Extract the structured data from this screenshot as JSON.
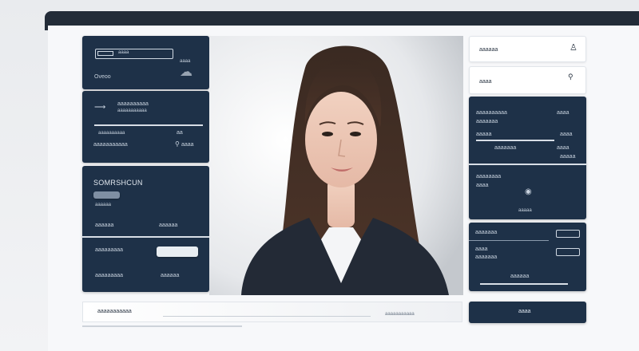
{
  "app": {
    "colors": {
      "panel": "#1e3148",
      "screen": "#f7f8fa",
      "light_card": "#ffffff",
      "text_light": "#c6d0dc"
    }
  },
  "panel_login": {
    "input_label": "aaaa",
    "caption": "Oveoo",
    "icon": "cloud-icon",
    "icon_label": "aaaa"
  },
  "panel_info": {
    "heading": "aaaaaaaaaa",
    "subheading": "aaaaaaaaaaa",
    "row1_label": "aaaaaaaaaa",
    "row1_value": "aa",
    "row2_label": "aaaaaaaaaaa",
    "row2_value": "aaaa"
  },
  "panel_search": {
    "title": "SOMRSHCUN",
    "item1_left": "aaaaaa",
    "item1_right": "aaaaaa",
    "row_label": "aaaaaa",
    "row2_left": "aaaaaaaaa",
    "row2_right": "aaaaaa"
  },
  "right_cards": {
    "card1_label": "aaaaaa",
    "card1_icon": "person-icon",
    "card2_label": "aaaa",
    "card2_icon": "pin-icon"
  },
  "panel_stats": {
    "title": "aaaaaaaaaa",
    "sub": "aaaaaaa",
    "row1_left": "aaaaa",
    "row1_right": "aaaa",
    "row2_left": "aaaaaaa",
    "row2_right": "aaaa",
    "row3_left": "aaaaa",
    "row3_right": "aaaa"
  },
  "panel_detail": {
    "title": "aaaaaaaa",
    "sub": "aaaa",
    "icon": "user-circle-icon",
    "caption": "aaaaa"
  },
  "panel_form": {
    "row1_left": "aaaaaaa",
    "row2_left": "aaaa",
    "row3_left": "aaaaaaa",
    "footer": "aaaaaa"
  },
  "bottom_bar": {
    "left_text": "aaaaaaaaaaa",
    "right_text": "aaaaaaaaaaa"
  },
  "action_button": {
    "label": "aaaa"
  }
}
